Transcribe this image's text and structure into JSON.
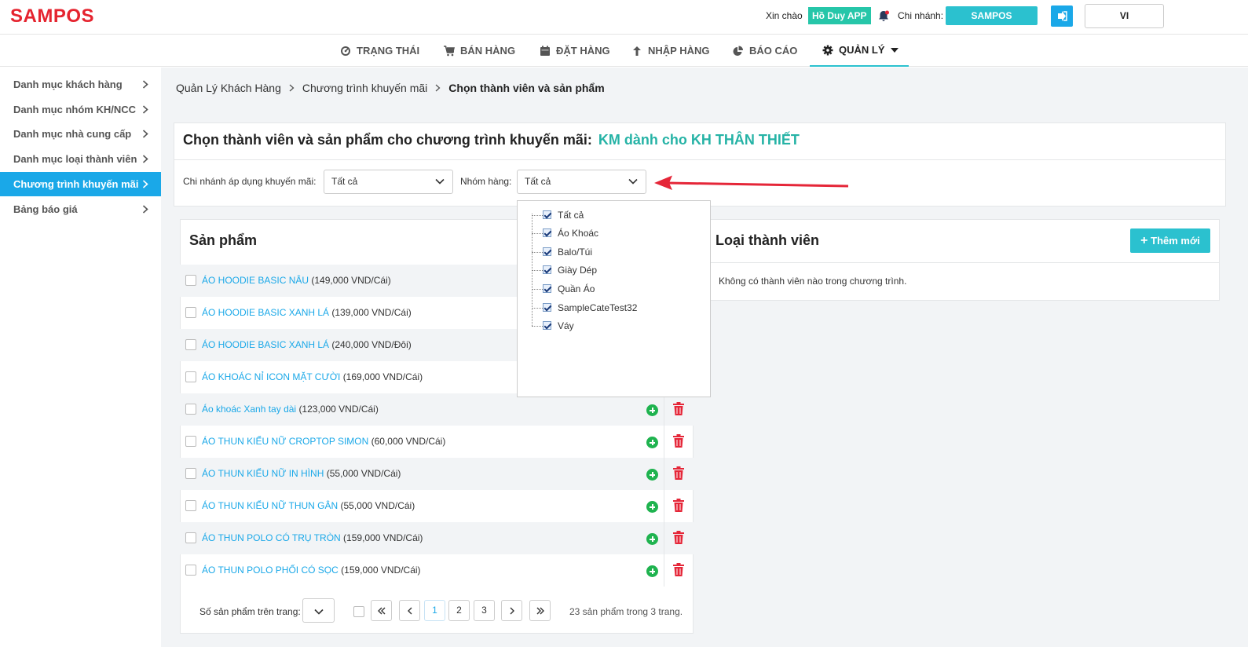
{
  "header": {
    "logo": "SAMPOS",
    "greeting": "Xin chào",
    "user": "Hồ Duy APP",
    "branch_label": "Chi nhánh:",
    "branch": "SAMPOS",
    "lang": "VI"
  },
  "nav": {
    "items": [
      {
        "label": "TRẠNG THÁI",
        "icon": "dashboard-icon"
      },
      {
        "label": "BÁN HÀNG",
        "icon": "cart-icon"
      },
      {
        "label": "ĐẶT HÀNG",
        "icon": "calendar-icon"
      },
      {
        "label": "NHẬP HÀNG",
        "icon": "upload-arrow-icon"
      },
      {
        "label": "BÁO CÁO",
        "icon": "pie-chart-icon"
      },
      {
        "label": "QUẢN LÝ",
        "icon": "gear-icon"
      }
    ]
  },
  "sidebar": {
    "items": [
      {
        "label": "Danh mục khách hàng"
      },
      {
        "label": "Danh mục nhóm KH/NCC"
      },
      {
        "label": "Danh mục nhà cung cấp"
      },
      {
        "label": "Danh mục loại thành viên"
      },
      {
        "label": "Chương trình khuyến mãi"
      },
      {
        "label": "Bảng báo giá"
      }
    ]
  },
  "breadcrumb": {
    "items": [
      "Quản Lý Khách Hàng",
      "Chương trình khuyến mãi"
    ],
    "current": "Chọn thành viên và sản phẩm"
  },
  "promo": {
    "title": "Chọn thành viên và sản phẩm cho chương trình khuyến mãi:",
    "name": "KM dành cho KH THÂN THIẾT",
    "branch_filter_label": "Chi nhánh áp dụng khuyến mãi:",
    "branch_filter_value": "Tất cả",
    "group_filter_label": "Nhóm hàng:",
    "group_filter_value": "Tất cả"
  },
  "group_dropdown": {
    "items": [
      {
        "label": "Tất cả",
        "checked": true
      },
      {
        "label": "Áo Khoác",
        "checked": true
      },
      {
        "label": "Balo/Túi",
        "checked": true
      },
      {
        "label": "Giày Dép",
        "checked": true
      },
      {
        "label": "Quần Áo",
        "checked": true
      },
      {
        "label": "SampleCateTest32",
        "checked": true
      },
      {
        "label": "Váy",
        "checked": true
      }
    ]
  },
  "products": {
    "title": "Sản phẩm",
    "rows": [
      {
        "name": "ÁO HOODIE BASIC NÂU",
        "price": "(149,000 VND/Cái)"
      },
      {
        "name": "ÁO HOODIE BASIC XANH LÁ",
        "price": "(139,000 VND/Cái)"
      },
      {
        "name": "ÁO HOODIE BASIC XANH LÁ",
        "price": "(240,000 VND/Đôi)"
      },
      {
        "name": "ÁO KHOÁC NỈ ICON MẶT CƯỜI",
        "price": "(169,000 VND/Cái)"
      },
      {
        "name": "Áo khoác Xanh tay dài",
        "price": "(123,000 VND/Cái)"
      },
      {
        "name": "ÁO THUN KIỂU NỮ CROPTOP SIMON",
        "price": "(60,000 VND/Cái)"
      },
      {
        "name": "ÁO THUN KIỂU NỮ IN HÌNH",
        "price": "(55,000 VND/Cái)"
      },
      {
        "name": "ÁO THUN KIỂU NỮ THUN GÂN",
        "price": "(55,000 VND/Cái)"
      },
      {
        "name": "ÁO THUN POLO CÓ TRỤ TRÒN",
        "price": "(159,000 VND/Cái)"
      },
      {
        "name": "ÁO THUN POLO PHỐI CÓ SỌC",
        "price": "(159,000 VND/Cái)"
      }
    ],
    "page_size_label": "Số sản phẩm trên trang:",
    "pages": [
      "1",
      "2",
      "3"
    ],
    "current_page": "1",
    "summary": "23 sản phẩm trong 3 trang."
  },
  "members": {
    "title": "Loại thành viên",
    "add_label": "Thêm mới",
    "empty": "Không có thành viên nào trong chương trình."
  },
  "colors": {
    "accent": "#2bc1cf",
    "link": "#1aa8e8",
    "brand": "#e5242f",
    "promo_name": "#26b3a6",
    "danger": "#e52638",
    "success": "#1fb34f"
  }
}
